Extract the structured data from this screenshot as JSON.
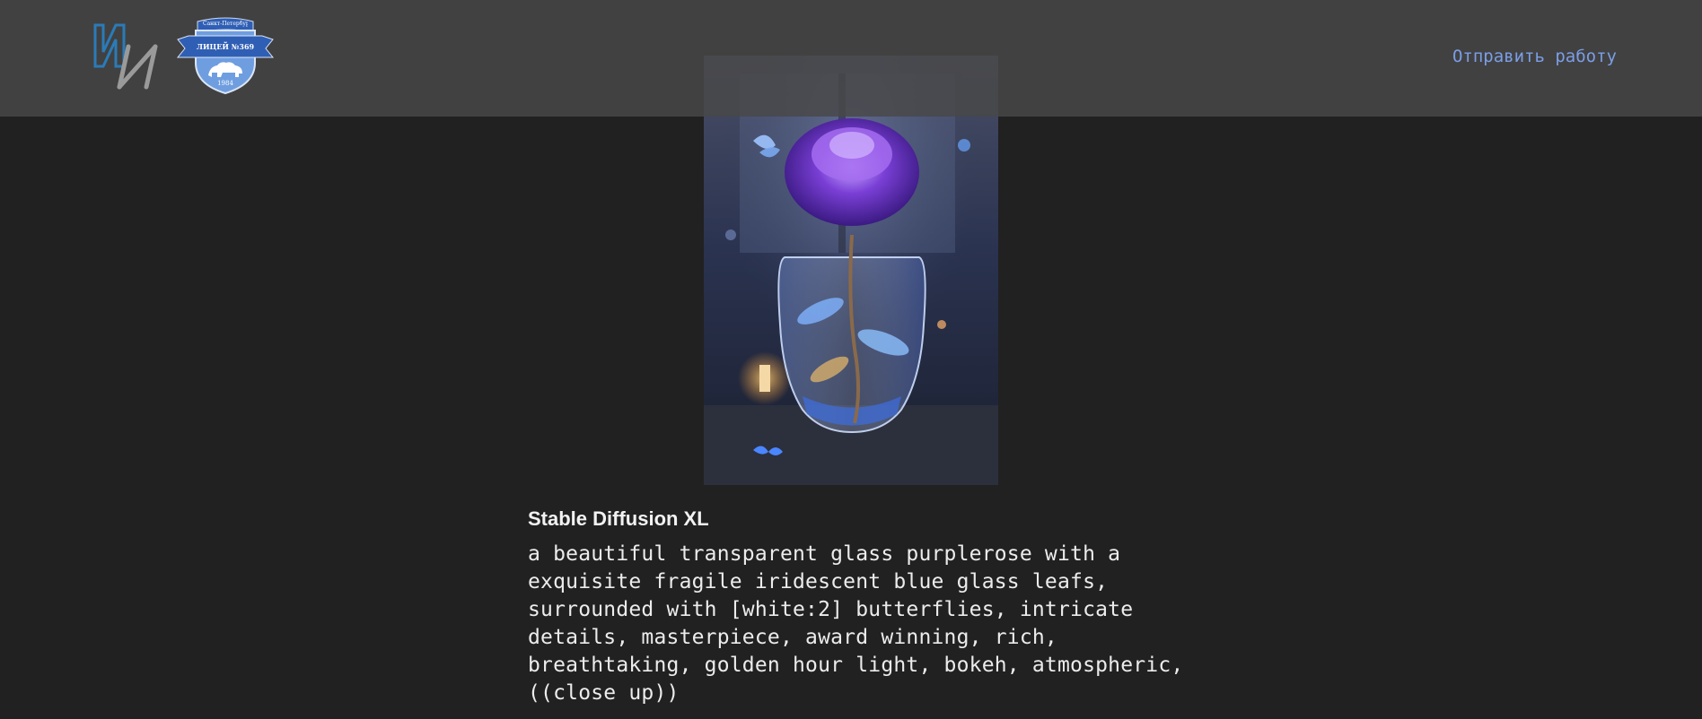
{
  "header": {
    "logo_ii_alt": "И",
    "crest": {
      "top_text": "Санкт-Петербург",
      "ribbon_text": "ЛИЦЕЙ №369",
      "year_text": "1984"
    },
    "submit_link": "Отправить работу",
    "colors": {
      "link": "#7b9ee6",
      "crest_blue": "#2f5fb5",
      "crest_light": "#6f9ee0"
    }
  },
  "artwork": {
    "subject": "purple glass rose in crystal vase"
  },
  "caption": {
    "model": "Stable Diffusion XL",
    "prompt": "a beautiful transparent glass purplerose with a\nexquisite fragile iridescent blue glass leafs,\nsurrounded with [white:2] butterflies, intricate\ndetails, masterpiece, award winning, rich,\nbreathtaking, golden hour light, bokeh, atmospheric,\n((close up))"
  }
}
